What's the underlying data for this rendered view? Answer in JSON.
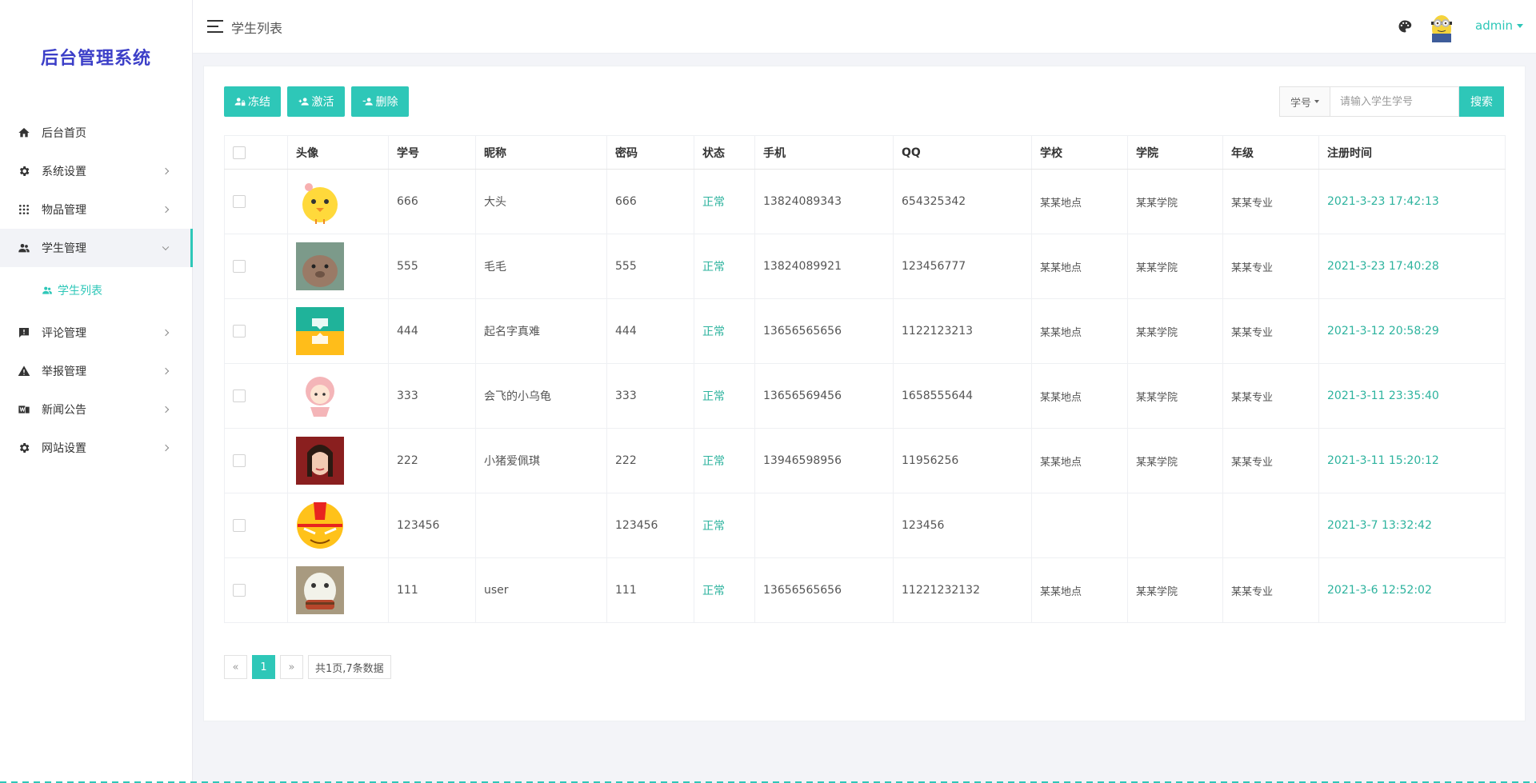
{
  "app": {
    "logo": "后台管理系统"
  },
  "sidebar": {
    "items": [
      {
        "label": "后台首页",
        "icon": "home-icon"
      },
      {
        "label": "系统设置",
        "icon": "gear-icon"
      },
      {
        "label": "物品管理",
        "icon": "grid-icon"
      },
      {
        "label": "学生管理",
        "icon": "people-icon"
      },
      {
        "label": "评论管理",
        "icon": "comment-icon"
      },
      {
        "label": "举报管理",
        "icon": "warning-icon"
      },
      {
        "label": "新闻公告",
        "icon": "news-icon"
      },
      {
        "label": "网站设置",
        "icon": "gear-icon"
      }
    ],
    "submenu": {
      "label": "学生列表",
      "icon": "people-icon"
    }
  },
  "header": {
    "title": "学生列表",
    "user": "admin"
  },
  "toolbar": {
    "freeze": "冻结",
    "activate": "激活",
    "delete": "删除"
  },
  "search": {
    "field": "学号",
    "placeholder": "请输入学生学号",
    "button": "搜索"
  },
  "table": {
    "columns": [
      "头像",
      "学号",
      "昵称",
      "密码",
      "状态",
      "手机",
      "QQ",
      "学校",
      "学院",
      "年级",
      "注册时间"
    ],
    "rows": [
      {
        "id": "666",
        "nick": "大头",
        "pwd": "666",
        "status": "正常",
        "phone": "13824089343",
        "qq": "654325342",
        "school": "某某地点",
        "college": "某某学院",
        "grade": "某某专业",
        "time": "2021-3-23 17:42:13"
      },
      {
        "id": "555",
        "nick": "毛毛",
        "pwd": "555",
        "status": "正常",
        "phone": "13824089921",
        "qq": "123456777",
        "school": "某某地点",
        "college": "某某学院",
        "grade": "某某专业",
        "time": "2021-3-23 17:40:28"
      },
      {
        "id": "444",
        "nick": "起名字真难",
        "pwd": "444",
        "status": "正常",
        "phone": "13656565656",
        "qq": "1122123213",
        "school": "某某地点",
        "college": "某某学院",
        "grade": "某某专业",
        "time": "2021-3-12 20:58:29"
      },
      {
        "id": "333",
        "nick": "会飞的小乌龟",
        "pwd": "333",
        "status": "正常",
        "phone": "13656569456",
        "qq": "1658555644",
        "school": "某某地点",
        "college": "某某学院",
        "grade": "某某专业",
        "time": "2021-3-11 23:35:40"
      },
      {
        "id": "222",
        "nick": "小猪爱佩琪",
        "pwd": "222",
        "status": "正常",
        "phone": "13946598956",
        "qq": "11956256",
        "school": "某某地点",
        "college": "某某学院",
        "grade": "某某专业",
        "time": "2021-3-11 15:20:12"
      },
      {
        "id": "123456",
        "nick": "",
        "pwd": "123456",
        "status": "正常",
        "phone": "",
        "qq": "123456",
        "school": "",
        "college": "",
        "grade": "",
        "time": "2021-3-7 13:32:42"
      },
      {
        "id": "111",
        "nick": "user",
        "pwd": "111",
        "status": "正常",
        "phone": "13656565656",
        "qq": "11221232132",
        "school": "某某地点",
        "college": "某某学院",
        "grade": "某某专业",
        "time": "2021-3-6 12:52:02"
      }
    ]
  },
  "pager": {
    "prev": "«",
    "page": "1",
    "next": "»",
    "info": "共1页,7条数据"
  },
  "colors": {
    "accent": "#2ec7b8",
    "logo": "#3c3fc8",
    "status": "#2db39e"
  }
}
